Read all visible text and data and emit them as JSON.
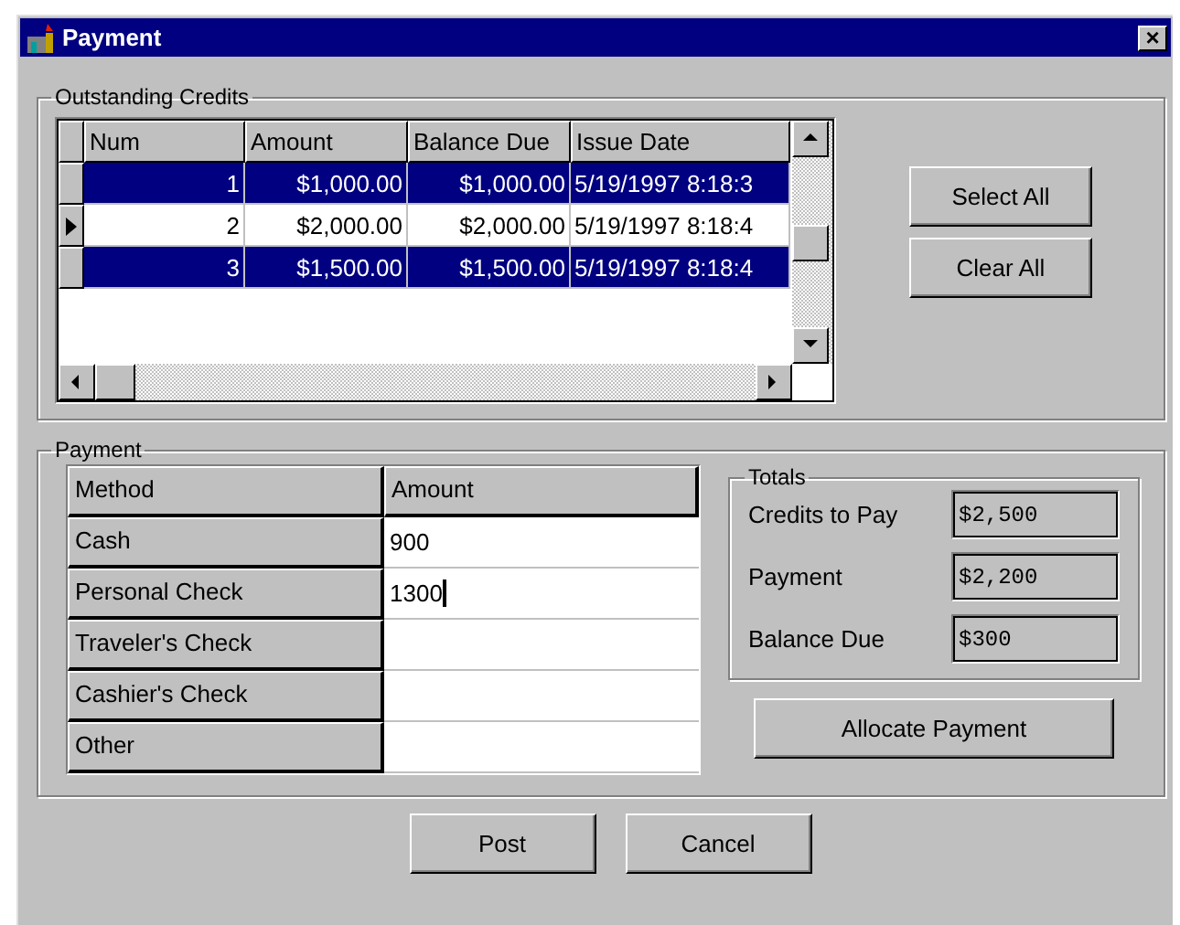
{
  "window": {
    "title": "Payment",
    "close": "×"
  },
  "outstanding_credits": {
    "label": "Outstanding Credits",
    "columns": [
      "Num",
      "Amount",
      "Balance Due",
      "Issue Date"
    ],
    "rows": [
      {
        "cells": [
          "1",
          "$1,000.00",
          "$1,000.00",
          "5/19/1997 8:18:3"
        ],
        "selected": true,
        "current": false
      },
      {
        "cells": [
          "2",
          "$2,000.00",
          "$2,000.00",
          "5/19/1997 8:18:4"
        ],
        "selected": false,
        "current": true
      },
      {
        "cells": [
          "3",
          "$1,500.00",
          "$1,500.00",
          "5/19/1997 8:18:4"
        ],
        "selected": true,
        "current": false
      }
    ],
    "buttons": [
      "Select All",
      "Clear All"
    ]
  },
  "payment": {
    "label": "Payment",
    "columns": [
      "Method",
      "Amount"
    ],
    "rows": [
      {
        "method": "Cash",
        "amount": "900",
        "focused": false
      },
      {
        "method": "Personal Check",
        "amount": "1300",
        "focused": true
      },
      {
        "method": "Traveler's Check",
        "focused": false
      },
      {
        "method": "Cashier's Check",
        "focused": false
      },
      {
        "method": "Other",
        "focused": false
      }
    ],
    "totals": {
      "label": "Totals",
      "fields": [
        {
          "label": "Credits to Pay",
          "value": "$2,500"
        },
        {
          "label": "Payment",
          "value": "$2,200"
        },
        {
          "label": "Balance Due",
          "value": "$300"
        }
      ]
    },
    "allocate_button": "Allocate Payment"
  },
  "buttons": [
    "Post",
    "Cancel"
  ]
}
